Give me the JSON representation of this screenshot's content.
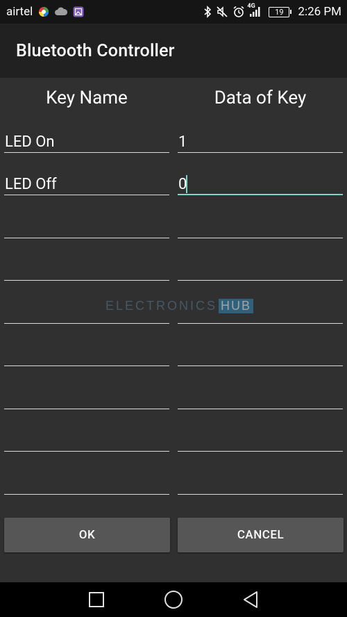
{
  "status_bar": {
    "carrier": "airtel",
    "network_type": "4G",
    "battery": "19",
    "time": "2:26 PM",
    "icons_left": [
      "colorwheel-icon",
      "cloud-icon",
      "gallery-icon"
    ],
    "icons_right": [
      "bluetooth-icon",
      "mute-icon",
      "alarm-icon",
      "signal-icon",
      "battery-icon"
    ]
  },
  "app_bar": {
    "title": "Bluetooth Controller"
  },
  "table": {
    "headers": {
      "key_name": "Key Name",
      "data_of_key": "Data of Key"
    },
    "rows": [
      {
        "key_name": "LED On",
        "data": "1"
      },
      {
        "key_name": "LED Off",
        "data": "0"
      },
      {
        "key_name": "",
        "data": ""
      },
      {
        "key_name": "",
        "data": ""
      },
      {
        "key_name": "",
        "data": ""
      },
      {
        "key_name": "",
        "data": ""
      },
      {
        "key_name": "",
        "data": ""
      },
      {
        "key_name": "",
        "data": ""
      },
      {
        "key_name": "",
        "data": ""
      }
    ]
  },
  "watermark": {
    "part1": "ELECTRONICS",
    "part2": "HUB"
  },
  "buttons": {
    "ok": "OK",
    "cancel": "CANCEL"
  },
  "colors": {
    "accent": "#7fd3c8",
    "app_bar": "#212121",
    "status_bar": "#151515",
    "content_bg": "#303030",
    "button": "#565656"
  },
  "nav": [
    "recents-square-icon",
    "home-circle-icon",
    "back-triangle-icon"
  ]
}
